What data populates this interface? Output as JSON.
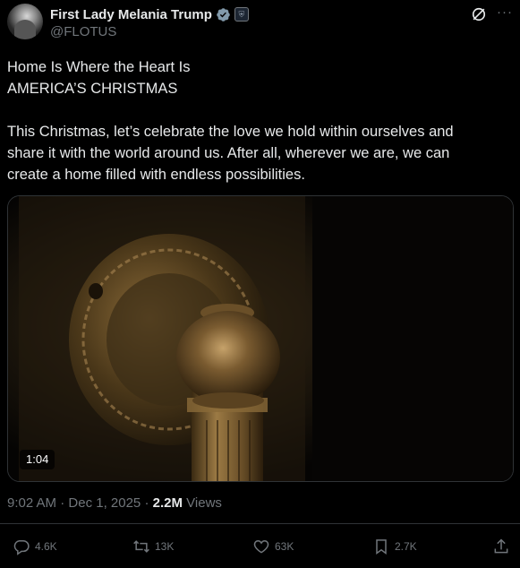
{
  "author": {
    "display_name": "First Lady Melania Trump",
    "handle": "@FLOTUS",
    "verified_badge_color": "#829aab",
    "gov_badge_icon": "government-seal-icon"
  },
  "header_icons": [
    "grok-icon",
    "more-icon"
  ],
  "more_label": "···",
  "tweet": {
    "lines_block1": [
      "Home Is Where the Heart Is",
      "AMERICA’S CHRISTMAS"
    ],
    "lines_block2": [
      "This Christmas, let’s celebrate the love we hold within ourselves and",
      "share it with the world around us. After all, wherever we are, we can",
      "create a home filled with endless possibilities."
    ]
  },
  "media": {
    "type": "video",
    "duration": "1:04"
  },
  "meta": {
    "time": "9:02 AM",
    "separator": "·",
    "date": "Dec 1, 2025",
    "views_count": "2.2M",
    "views_label": "Views"
  },
  "actions": {
    "reply": "4.6K",
    "repost": "13K",
    "like": "63K",
    "bookmark": "2.7K"
  },
  "colors": {
    "background": "#000000",
    "text": "#e7e9ea",
    "muted": "#71767b",
    "border": "#2f3336"
  }
}
